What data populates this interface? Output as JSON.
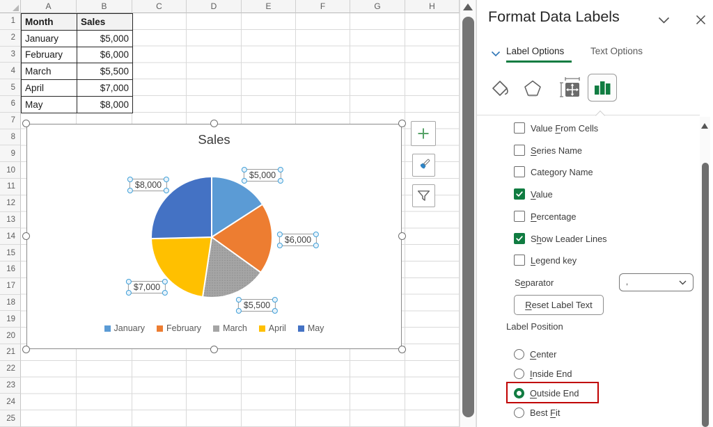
{
  "spreadsheet": {
    "column_headers": [
      "A",
      "B",
      "C",
      "D",
      "E",
      "F",
      "G",
      "H"
    ],
    "row_headers": [
      "1",
      "2",
      "3",
      "4",
      "5",
      "6",
      "7",
      "8",
      "9",
      "10",
      "11",
      "12",
      "13",
      "14",
      "15",
      "16",
      "17",
      "18",
      "19",
      "20",
      "21",
      "22",
      "23",
      "24",
      "25"
    ],
    "table": {
      "headers": [
        "Month",
        "Sales"
      ],
      "rows": [
        [
          "January",
          "$5,000"
        ],
        [
          "February",
          "$6,000"
        ],
        [
          "March",
          "$5,500"
        ],
        [
          "April",
          "$7,000"
        ],
        [
          "May",
          "$8,000"
        ]
      ]
    }
  },
  "chart_data": {
    "type": "pie",
    "title": "Sales",
    "categories": [
      "January",
      "February",
      "March",
      "April",
      "May"
    ],
    "values": [
      5000,
      6000,
      5500,
      7000,
      8000
    ],
    "data_labels": [
      "$5,000",
      "$6,000",
      "$5,500",
      "$7,000",
      "$8,000"
    ],
    "colors": [
      "#5B9BD5",
      "#ED7D31",
      "#A5A5A5",
      "#FFC000",
      "#4472C4"
    ],
    "slice_fill_style": [
      "solid",
      "solid",
      "dotted",
      "solid",
      "solid"
    ],
    "legend_position": "bottom",
    "start_angle_deg": 0,
    "direction": "clockwise"
  },
  "chart_tools": {
    "buttons": [
      "chart-elements",
      "chart-styles",
      "chart-filters"
    ]
  },
  "panel": {
    "title": "Format Data Labels",
    "tabs": [
      {
        "label": "Label Options",
        "active": true
      },
      {
        "label": "Text Options",
        "active": false
      }
    ],
    "toolbar_icons": [
      "fill-and-line",
      "effects",
      "size-and-properties",
      "label-options"
    ],
    "selected_toolbar_icon": "label-options",
    "checkboxes": [
      {
        "pre": "Value ",
        "u": "F",
        "post": "rom Cells",
        "checked": false
      },
      {
        "pre": "",
        "u": "S",
        "post": "eries Name",
        "checked": false
      },
      {
        "pre": "Cate",
        "u": "g",
        "post": "ory Name",
        "checked": false
      },
      {
        "pre": "",
        "u": "V",
        "post": "alue",
        "checked": true
      },
      {
        "pre": "",
        "u": "P",
        "post": "ercentage",
        "checked": false
      },
      {
        "pre": "S",
        "u": "h",
        "post": "ow Leader Lines",
        "checked": true
      },
      {
        "pre": "",
        "u": "L",
        "post": "egend key",
        "checked": false
      }
    ],
    "separator": {
      "pre": "S",
      "u": "e",
      "post": "parator",
      "value": ","
    },
    "reset_button": {
      "pre": "",
      "u": "R",
      "post": "eset Label Text"
    },
    "label_position_header": "Label Position",
    "radios": [
      {
        "pre": "",
        "u": "C",
        "post": "enter",
        "selected": false,
        "highlighted": false
      },
      {
        "pre": "",
        "u": "I",
        "post": "nside End",
        "selected": false,
        "highlighted": false
      },
      {
        "pre": "",
        "u": "O",
        "post": "utside End",
        "selected": true,
        "highlighted": true
      },
      {
        "pre": "Best ",
        "u": "F",
        "post": "it",
        "selected": false,
        "highlighted": false
      }
    ],
    "colors": {
      "accent_green": "#107C41",
      "highlight_red": "#C00000",
      "tab_chevron_blue": "#2E75B6"
    }
  }
}
